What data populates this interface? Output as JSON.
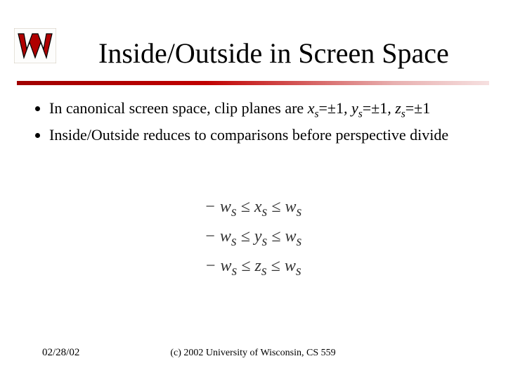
{
  "title": "Inside/Outside in Screen Space",
  "bullets": [
    {
      "prefix": "In canonical screen space, clip planes are ",
      "vars": [
        "x",
        "y",
        "z"
      ],
      "eq": "=±1"
    },
    {
      "text": "Inside/Outside reduces to comparisons before perspective divide"
    }
  ],
  "equations": {
    "lhs_prefix": "− w",
    "lhs_sub": "s",
    "rel": " ≤ ",
    "vars": [
      "x",
      "y",
      "z"
    ],
    "mid_sub": "s",
    "rhs_prefix": "w",
    "rhs_sub": "s"
  },
  "footer": {
    "date": "02/28/02",
    "copyright": "(c) 2002 University of Wisconsin, CS 559"
  }
}
